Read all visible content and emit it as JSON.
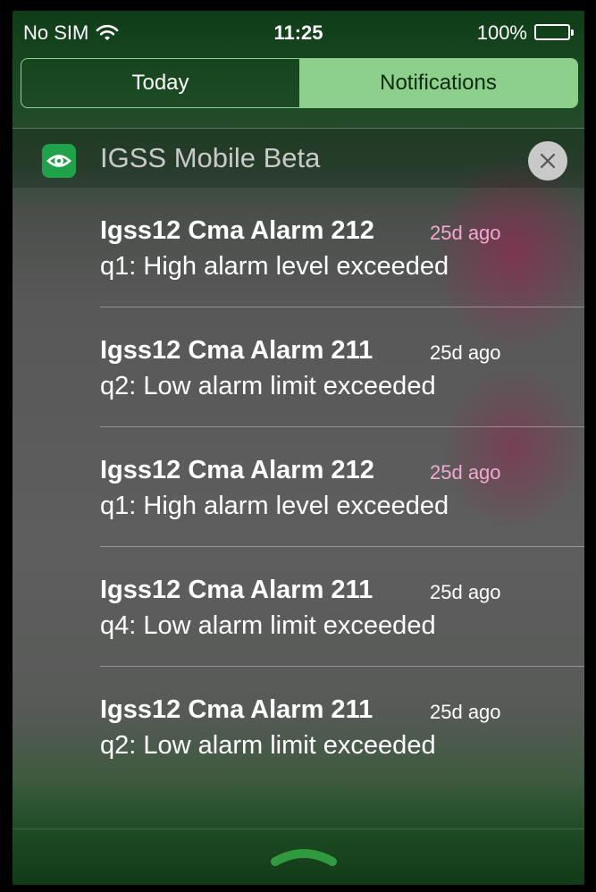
{
  "status_bar": {
    "carrier": "No SIM",
    "time": "11:25",
    "battery": "100%"
  },
  "tabs": [
    {
      "label": "Today",
      "active": false
    },
    {
      "label": "Notifications",
      "active": true
    }
  ],
  "app_group": {
    "name": "IGSS Mobile Beta",
    "icon": "eye-icon"
  },
  "notifications": [
    {
      "title": "Igss12 Cma Alarm 212",
      "time": "25d ago",
      "body": "q1: High alarm level exceeded"
    },
    {
      "title": "Igss12 Cma Alarm 211",
      "time": "25d ago",
      "body": "q2: Low alarm limit exceeded"
    },
    {
      "title": "Igss12 Cma Alarm 212",
      "time": "25d ago",
      "body": "q1: High alarm level exceeded"
    },
    {
      "title": "Igss12 Cma Alarm 211",
      "time": "25d ago",
      "body": "q4: Low alarm limit exceeded"
    },
    {
      "title": "Igss12 Cma Alarm 211",
      "time": "25d ago",
      "body": "q2: Low alarm limit exceeded"
    }
  ],
  "colors": {
    "accent_green": "#8dd08b",
    "app_icon_green": "#1fa24a"
  }
}
